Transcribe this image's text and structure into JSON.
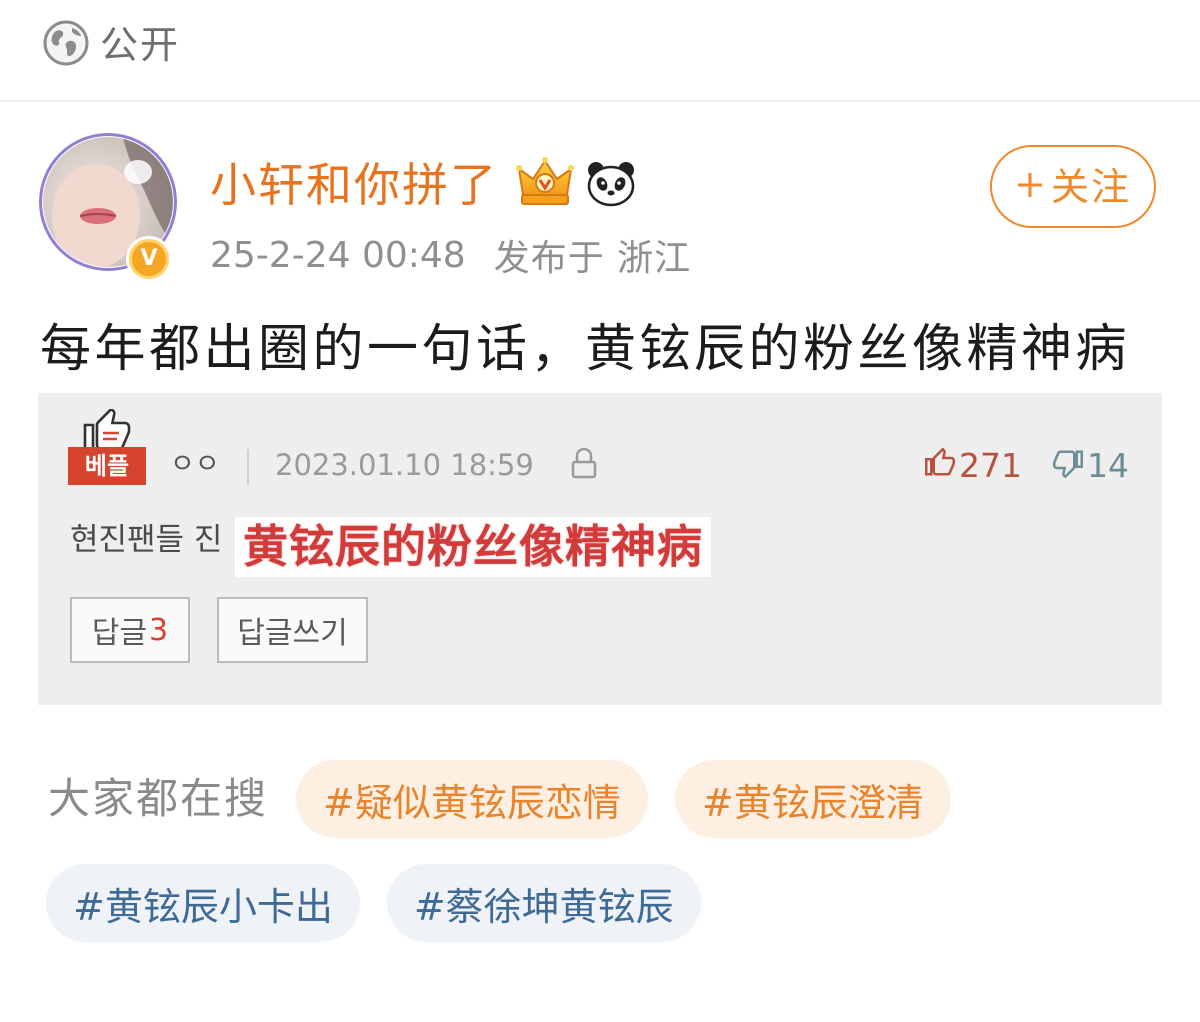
{
  "visibility": {
    "icon": "globe-icon",
    "label": "公开"
  },
  "author": {
    "name": "小轩和你拼了",
    "verified_badge": "V",
    "badges": [
      "crown-badge-icon",
      "panda-icon"
    ],
    "timestamp": "25-2-24 00:48",
    "location": "发布于 浙江"
  },
  "follow_button": {
    "icon": "plus-icon",
    "label": "关注"
  },
  "post": {
    "text": "每年都出圈的一句话，黄铉辰的粉丝像精神病",
    "image": {
      "best_icon": "thumbs-up-icon",
      "best_badge": "베플",
      "username": "ㅇㅇ",
      "datetime": "2023.01.10 18:59",
      "lock_icon": "lock-icon",
      "likes": 271,
      "dislikes": 14,
      "comment_text": "현진팬들 진",
      "overlay_text": "黄铉辰的粉丝像精神病",
      "reply_button": {
        "label": "답글",
        "count": 3
      },
      "write_reply_button": {
        "label": "답글쓰기"
      }
    }
  },
  "trending": {
    "label": "大家都在搜",
    "tags": [
      {
        "text": "#疑似黄铉辰恋情",
        "color": "#e9842d",
        "background": "#fdf0e3"
      },
      {
        "text": "#黄铉辰澄清",
        "color": "#e9842d",
        "background": "#fdf0e3"
      },
      {
        "text": "#黄铉辰小卡出",
        "color": "#3e6a97",
        "background": "#eff3f7"
      },
      {
        "text": "#蔡徐坤黄铉辰",
        "color": "#3e6a97",
        "background": "#eff3f7"
      }
    ]
  },
  "colors": {
    "username": "#e8731f",
    "follow": "#ef8a2b",
    "best_badge": "#d64430",
    "likes": "#b6523e",
    "dislikes": "#6b8e98",
    "overlay_text": "#d33b3b",
    "reply_count": "#d64430"
  }
}
